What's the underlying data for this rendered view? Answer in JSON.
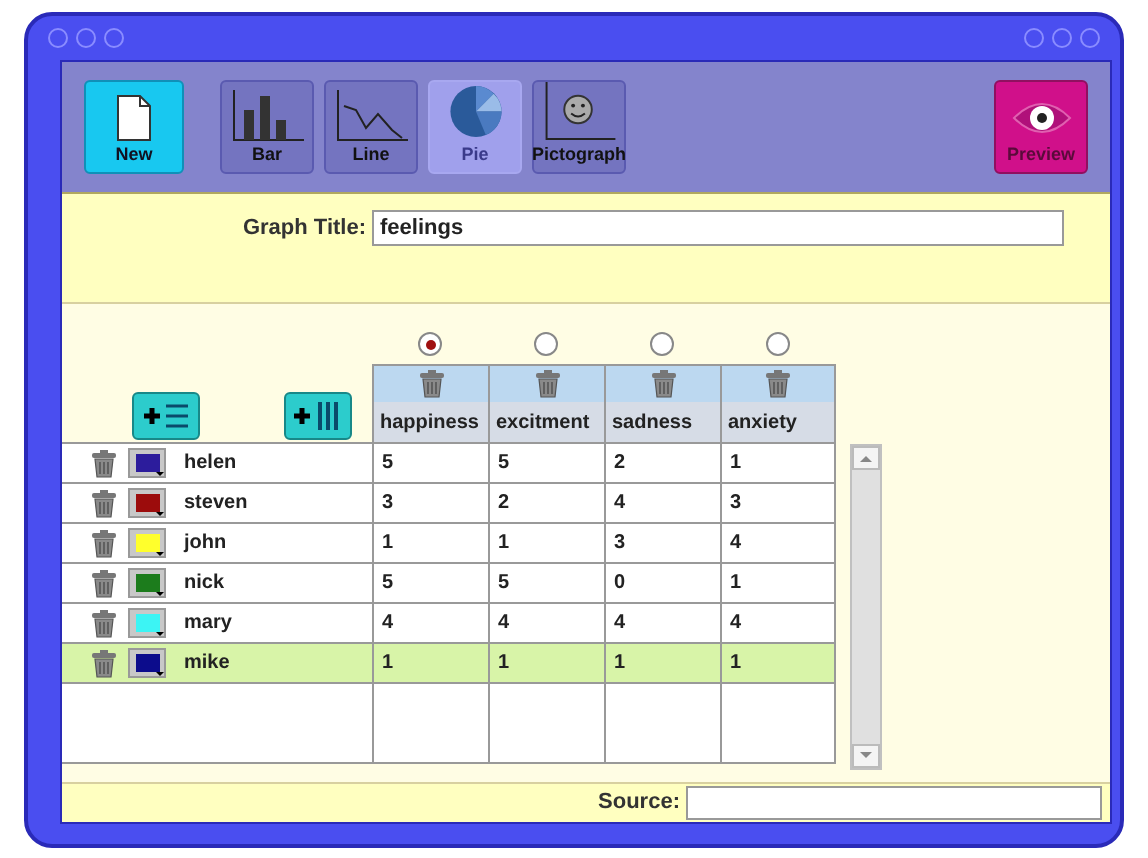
{
  "toolbar": {
    "new_button": "New",
    "chart_types": [
      {
        "label": "Bar",
        "kind": "bar",
        "selected": false
      },
      {
        "label": "Line",
        "kind": "line",
        "selected": false
      },
      {
        "label": "Pie",
        "kind": "pie",
        "selected": true
      },
      {
        "label": "Pictograph",
        "kind": "pictograph",
        "selected": false
      }
    ],
    "preview_button": "Preview"
  },
  "graph_title": {
    "label": "Graph Title:",
    "value": "feelings"
  },
  "table": {
    "columns": [
      {
        "label": "happiness",
        "selected": true
      },
      {
        "label": "excitment",
        "selected": false
      },
      {
        "label": "sadness",
        "selected": false
      },
      {
        "label": "anxiety",
        "selected": false
      }
    ],
    "rows": [
      {
        "name": "helen",
        "color": "#2c1c9c",
        "selected": false,
        "values": [
          "5",
          "5",
          "2",
          "1"
        ]
      },
      {
        "name": "steven",
        "color": "#9c0c0c",
        "selected": false,
        "values": [
          "3",
          "2",
          "4",
          "3"
        ]
      },
      {
        "name": "john",
        "color": "#ffff2c",
        "selected": false,
        "values": [
          "1",
          "1",
          "3",
          "4"
        ]
      },
      {
        "name": "nick",
        "color": "#1c7c1c",
        "selected": false,
        "values": [
          "5",
          "5",
          "0",
          "1"
        ]
      },
      {
        "name": "mary",
        "color": "#3cf4f4",
        "selected": false,
        "values": [
          "4",
          "4",
          "4",
          "4"
        ]
      },
      {
        "name": "mike",
        "color": "#0c0c8c",
        "selected": true,
        "values": [
          "1",
          "1",
          "1",
          "1"
        ]
      }
    ]
  },
  "source": {
    "label": "Source:"
  }
}
